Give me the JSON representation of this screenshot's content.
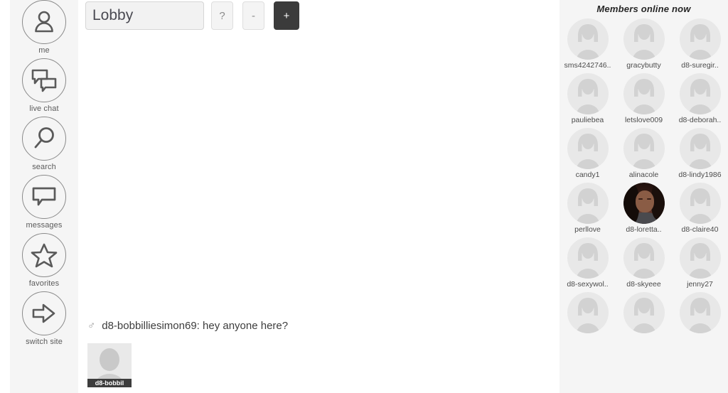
{
  "sidebar": {
    "items": [
      {
        "label": "me",
        "icon": "person-icon"
      },
      {
        "label": "live chat",
        "icon": "chat-bubbles-icon"
      },
      {
        "label": "search",
        "icon": "magnifier-icon"
      },
      {
        "label": "messages",
        "icon": "message-bubble-icon"
      },
      {
        "label": "favorites",
        "icon": "star-icon"
      },
      {
        "label": "switch site",
        "icon": "arrow-right-icon"
      }
    ]
  },
  "toolbar": {
    "room_value": "Lobby",
    "room_placeholder": "Lobby",
    "help_label": "?",
    "minus_label": "-",
    "plus_label": "+"
  },
  "chat": {
    "messages": [
      {
        "gender_icon": "male-symbol",
        "gender_glyph": "♂",
        "username": "d8-bobbilliesimon69",
        "separator": ": ",
        "text": "hey anyone here?",
        "full_line": "d8-bobbilliesimon69: hey anyone here?"
      }
    ],
    "thumbnail": {
      "caption": "d8-bobbil",
      "avatar_icon": "default-person-avatar"
    }
  },
  "members": {
    "title": "Members online now",
    "list": [
      {
        "name": "sms4242746..",
        "avatar": "default-female-avatar"
      },
      {
        "name": "gracybutty",
        "avatar": "default-female-avatar"
      },
      {
        "name": "d8-suregir..",
        "avatar": "default-female-avatar"
      },
      {
        "name": "pauliebea",
        "avatar": "default-female-avatar"
      },
      {
        "name": "letslove009",
        "avatar": "default-female-avatar"
      },
      {
        "name": "d8-deborah..",
        "avatar": "default-female-avatar"
      },
      {
        "name": "candy1",
        "avatar": "default-female-avatar"
      },
      {
        "name": "alinacole",
        "avatar": "default-female-avatar"
      },
      {
        "name": "d8-lindy1986",
        "avatar": "default-female-avatar"
      },
      {
        "name": "perllove",
        "avatar": "default-female-avatar"
      },
      {
        "name": "d8-loretta..",
        "avatar": "photo-avatar"
      },
      {
        "name": "d8-claire40",
        "avatar": "default-female-avatar"
      },
      {
        "name": "d8-sexywol..",
        "avatar": "default-female-avatar"
      },
      {
        "name": "d8-skyeee",
        "avatar": "default-female-avatar"
      },
      {
        "name": "jenny27",
        "avatar": "default-female-avatar"
      },
      {
        "name": "",
        "avatar": "default-female-avatar"
      },
      {
        "name": "",
        "avatar": "default-female-avatar"
      },
      {
        "name": "",
        "avatar": "default-female-avatar"
      }
    ]
  },
  "colors": {
    "panel_bg": "#f5f5f5",
    "main_bg": "#ffffff",
    "accent_dark": "#3b3b3b",
    "text": "#4c4c4c",
    "avatar_circle": "#e8e8e8",
    "avatar_fill": "#d0d0d0"
  }
}
